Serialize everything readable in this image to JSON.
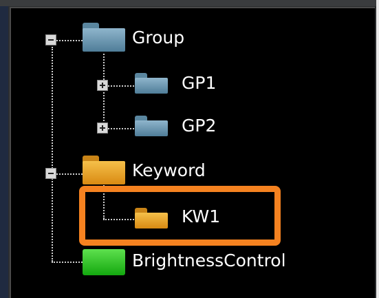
{
  "tree": {
    "items": [
      {
        "label": "Group",
        "expander": "collapse",
        "icon": "folder-blue-icon"
      },
      {
        "label": "GP1",
        "expander": "expand",
        "icon": "folder-blue-icon"
      },
      {
        "label": "GP2",
        "expander": "expand",
        "icon": "folder-blue-icon"
      },
      {
        "label": "Keyword",
        "expander": "collapse",
        "icon": "folder-orange-icon"
      },
      {
        "label": "KW1",
        "expander": "none",
        "icon": "folder-orange-icon"
      },
      {
        "label": "BrightnessControl",
        "expander": "none",
        "icon": "green-box-icon"
      }
    ],
    "highlighted_item": "KW1"
  },
  "colors": {
    "background": "#000000",
    "highlight_border": "#f58220",
    "folder_blue": "#6e9ab6",
    "folder_orange": "#e8a021",
    "green_box": "#22c01e",
    "text": "#ffffff"
  }
}
